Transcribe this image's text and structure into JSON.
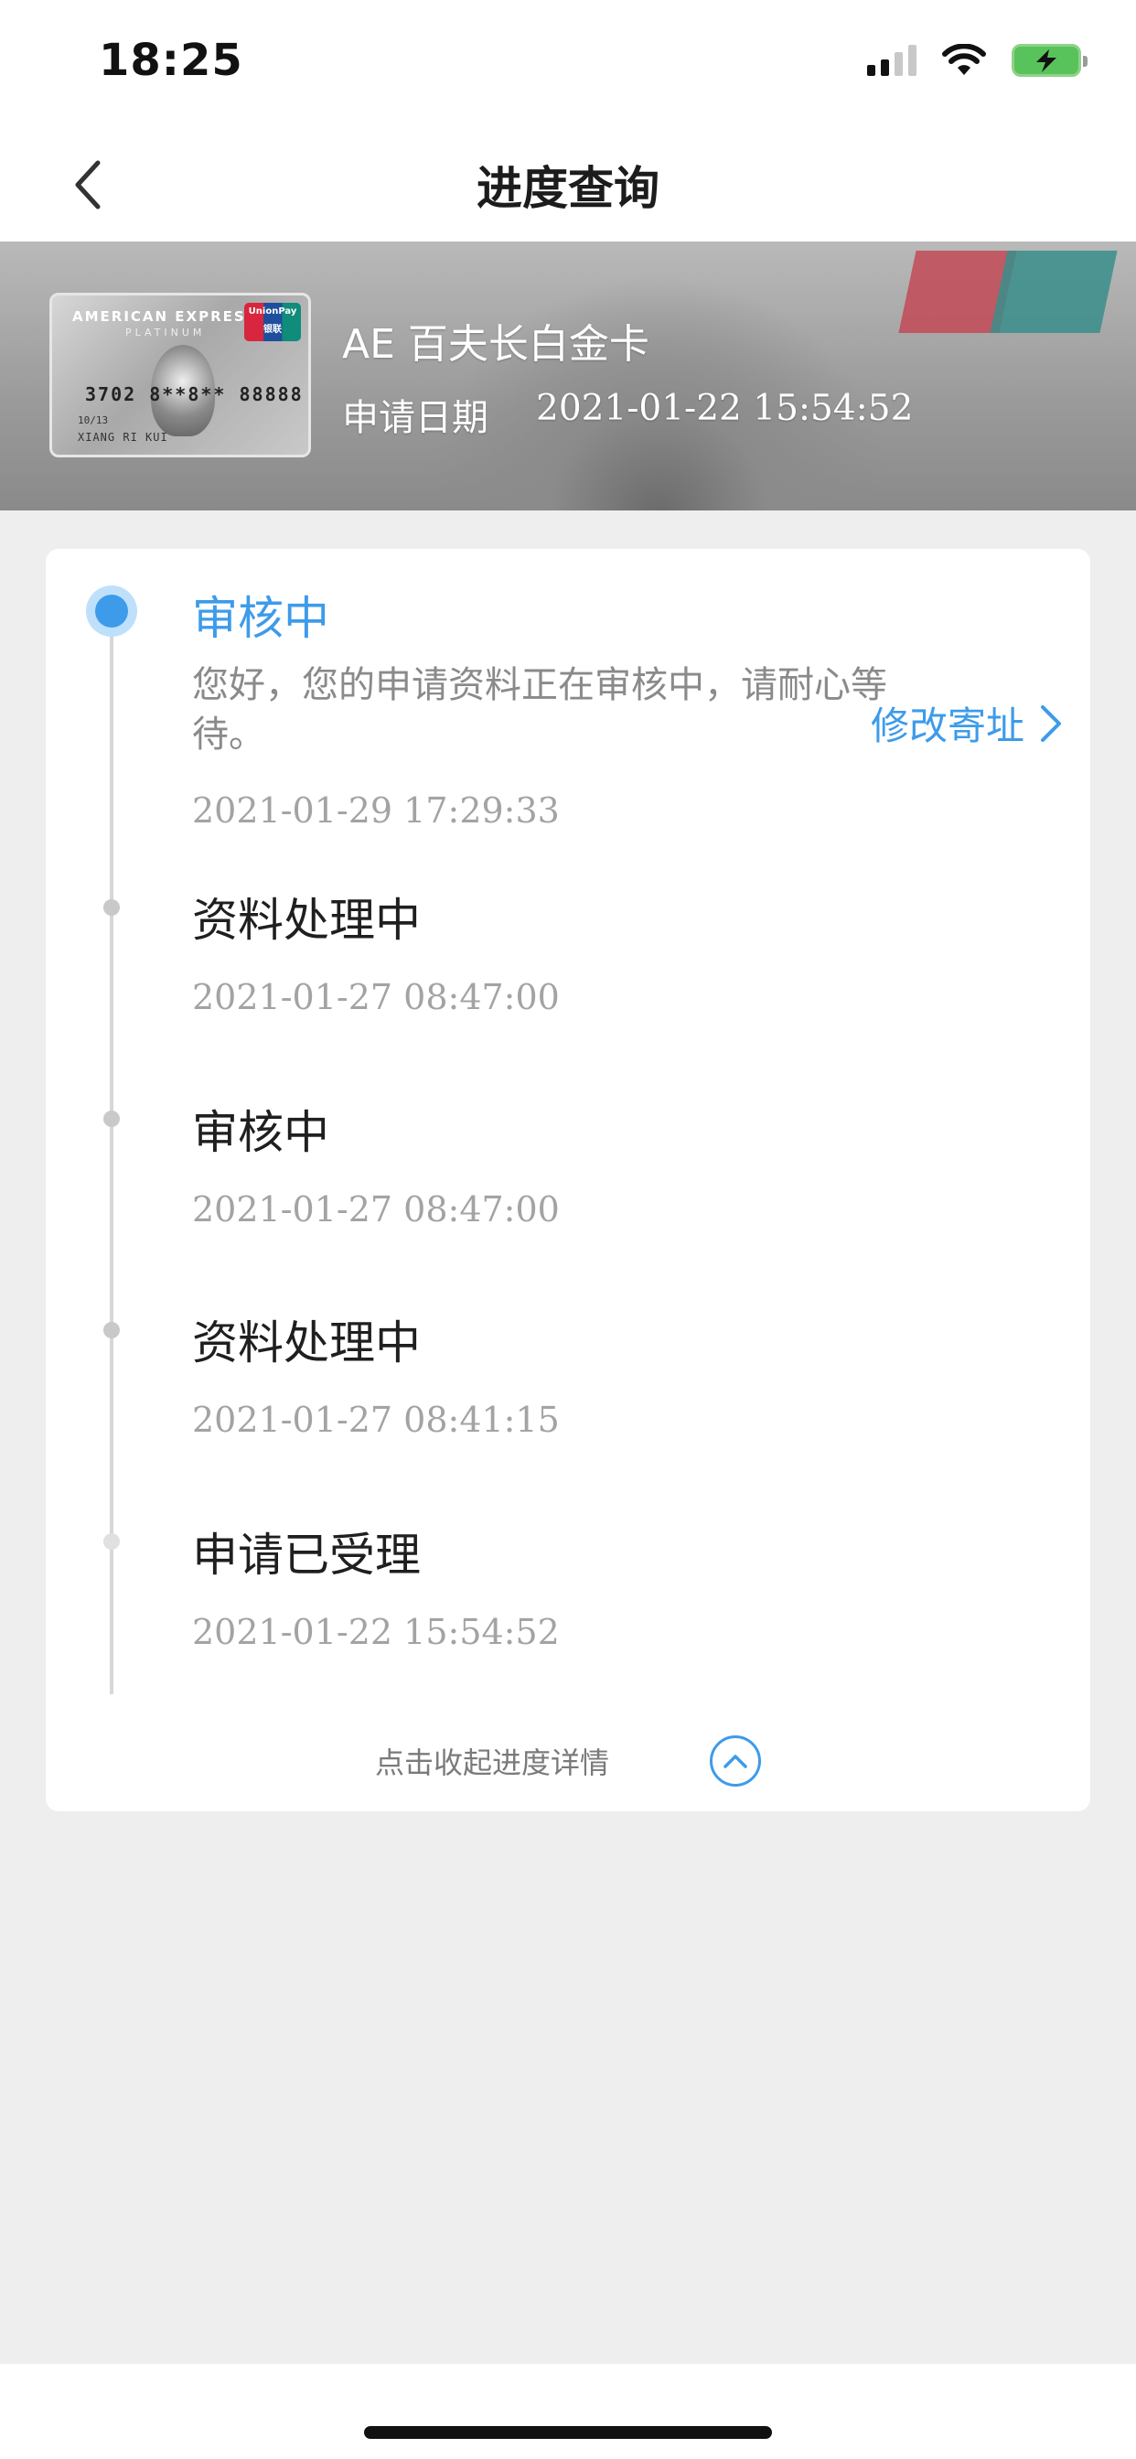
{
  "status_bar": {
    "time": "18:25",
    "icons": [
      "signal-icon",
      "wifi-icon",
      "battery-charging-icon"
    ]
  },
  "nav": {
    "title": "进度查询",
    "back_icon": "chevron-left-icon"
  },
  "card": {
    "thumb": {
      "brand": "AMERICAN EXPRESS",
      "tier": "PLATINUM",
      "network": "UnionPay 银联",
      "number": "3702 8**8** 88888",
      "holder": "XIANG RI KUI",
      "expiry": "10/13"
    },
    "name": "AE 百夫长白金卡",
    "apply_date_label": "申请日期",
    "apply_date_value": "2021-01-22 15:54:52"
  },
  "progress": {
    "current": {
      "title": "审核中",
      "description": "您好，您的申请资料正在审核中，请耐心等待。",
      "time": "2021-01-29 17:29:33",
      "action_label": "修改寄址"
    },
    "history": [
      {
        "title": "资料处理中",
        "time": "2021-01-27 08:47:00"
      },
      {
        "title": "审核中",
        "time": "2021-01-27 08:47:00"
      },
      {
        "title": "资料处理中",
        "time": "2021-01-27 08:41:15"
      },
      {
        "title": "申请已受理",
        "time": "2021-01-22 15:54:52"
      }
    ],
    "collapse_label": "点击收起进度详情"
  },
  "colors": {
    "accent": "#3d9bea",
    "page_bg": "#eeeeee",
    "card_bg": "#ffffff",
    "muted_text": "#a3a3a3"
  }
}
